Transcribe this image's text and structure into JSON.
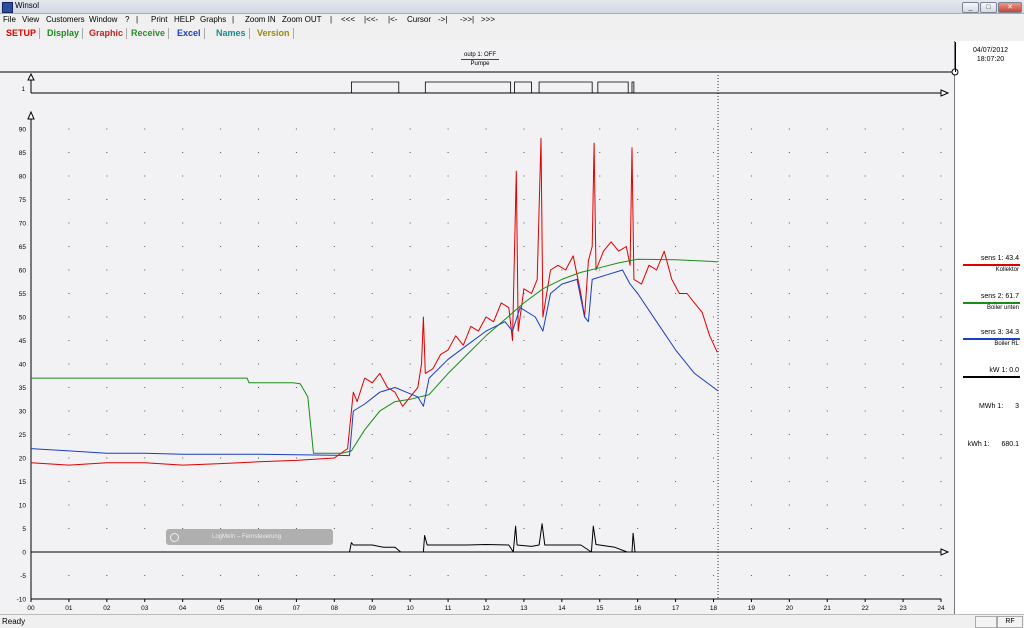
{
  "window": {
    "title": "Winsol"
  },
  "menu": [
    "File",
    "View",
    "Customers",
    "Window",
    "?",
    "|",
    "Print",
    "HELP",
    "Graphs",
    "|",
    "Zoom IN",
    "Zoom OUT",
    "|",
    "<<<",
    "|<<-",
    "|<-",
    "Cursor",
    "->|",
    "->>|",
    ">>>"
  ],
  "toolbar": [
    {
      "label": "SETUP",
      "color": "#e00000"
    },
    {
      "label": "Display",
      "color": "#1a8c1a"
    },
    {
      "label": "Graphic",
      "color": "#c41e1e"
    },
    {
      "label": "Receive",
      "color": "#2e8b2e"
    },
    {
      "label": "Excel",
      "color": "#1a3fbf"
    },
    {
      "label": "Names",
      "color": "#138f8f"
    },
    {
      "label": "Version",
      "color": "#9a8a0a"
    }
  ],
  "header": {
    "date": "04/07/2012",
    "time": "18:07:20",
    "output_label": "outp 1: OFF",
    "output_name": "Pumpe"
  },
  "legend": [
    {
      "label": "sens 1:",
      "value": "43.4",
      "name": "Kollektor",
      "color": "#e00000"
    },
    {
      "label": "sens 2:",
      "value": "61.7",
      "name": "Boiler unten",
      "color": "#1a8c1a"
    },
    {
      "label": "sens 3:",
      "value": "34.3",
      "name": "Boiler RL",
      "color": "#1a3fbf"
    },
    {
      "label": "kW 1:",
      "value": "0.0",
      "name": "",
      "color": "#000000"
    }
  ],
  "counters": [
    {
      "label": "MWh 1:",
      "value": "3"
    },
    {
      "label": "kWh 1:",
      "value": "680.1"
    }
  ],
  "status": {
    "text": "Ready",
    "rf": "RF"
  },
  "toast": {
    "text": "LogMeIn – Fernsteuerung"
  },
  "chart_data": {
    "type": "line",
    "xlabel": "",
    "ylabel": "",
    "xlim": [
      0,
      24
    ],
    "ylim": [
      -10,
      90
    ],
    "x_ticks": [
      "00",
      "01",
      "02",
      "03",
      "04",
      "05",
      "06",
      "07",
      "08",
      "09",
      "10",
      "11",
      "12",
      "13",
      "14",
      "15",
      "16",
      "17",
      "18",
      "19",
      "20",
      "21",
      "22",
      "23",
      "24"
    ],
    "y_ticks": [
      -10,
      -5,
      0,
      5,
      10,
      15,
      20,
      25,
      30,
      35,
      40,
      45,
      50,
      55,
      60,
      65,
      70,
      75,
      80,
      85,
      90
    ],
    "cursor_x": 18.12,
    "pump": {
      "label": "1",
      "on_intervals": [
        [
          8.45,
          9.7
        ],
        [
          10.4,
          12.65
        ],
        [
          12.75,
          13.2
        ],
        [
          13.4,
          14.8
        ],
        [
          14.95,
          15.75
        ],
        [
          15.85,
          15.9
        ]
      ]
    },
    "series": [
      {
        "name": "Kollektor",
        "color": "#e00000",
        "points": [
          [
            0,
            19
          ],
          [
            1,
            18.5
          ],
          [
            2,
            19
          ],
          [
            3,
            19
          ],
          [
            4,
            18.5
          ],
          [
            5,
            18.8
          ],
          [
            6,
            19.2
          ],
          [
            7,
            19.5
          ],
          [
            8,
            20
          ],
          [
            8.35,
            22
          ],
          [
            8.5,
            34
          ],
          [
            8.6,
            32
          ],
          [
            8.8,
            37
          ],
          [
            9,
            36
          ],
          [
            9.2,
            38
          ],
          [
            9.4,
            35
          ],
          [
            9.6,
            34
          ],
          [
            9.8,
            31
          ],
          [
            10,
            33
          ],
          [
            10.2,
            35
          ],
          [
            10.3,
            40
          ],
          [
            10.35,
            50
          ],
          [
            10.4,
            38
          ],
          [
            10.6,
            39
          ],
          [
            10.8,
            42
          ],
          [
            11,
            43
          ],
          [
            11.2,
            46
          ],
          [
            11.4,
            44
          ],
          [
            11.6,
            48
          ],
          [
            11.8,
            47
          ],
          [
            12,
            50
          ],
          [
            12.2,
            49
          ],
          [
            12.4,
            53
          ],
          [
            12.6,
            52
          ],
          [
            12.7,
            45
          ],
          [
            12.8,
            81
          ],
          [
            12.85,
            47
          ],
          [
            13,
            56
          ],
          [
            13.2,
            55
          ],
          [
            13.35,
            58
          ],
          [
            13.45,
            88
          ],
          [
            13.5,
            50
          ],
          [
            13.7,
            60
          ],
          [
            13.9,
            61
          ],
          [
            14.1,
            60
          ],
          [
            14.3,
            63
          ],
          [
            14.5,
            55
          ],
          [
            14.6,
            50
          ],
          [
            14.7,
            62
          ],
          [
            14.8,
            65
          ],
          [
            14.85,
            87
          ],
          [
            14.9,
            60
          ],
          [
            15.1,
            64
          ],
          [
            15.3,
            66
          ],
          [
            15.5,
            64
          ],
          [
            15.7,
            65
          ],
          [
            15.8,
            61
          ],
          [
            15.85,
            86
          ],
          [
            15.9,
            58
          ],
          [
            16.1,
            57
          ],
          [
            16.3,
            61
          ],
          [
            16.5,
            60
          ],
          [
            16.7,
            64
          ],
          [
            16.9,
            58
          ],
          [
            17.1,
            55
          ],
          [
            17.3,
            55
          ],
          [
            17.5,
            53
          ],
          [
            17.7,
            51
          ],
          [
            17.9,
            46
          ],
          [
            18.1,
            42.5
          ]
        ]
      },
      {
        "name": "Boiler unten",
        "color": "#1a8c1a",
        "points": [
          [
            0,
            37
          ],
          [
            5.7,
            37
          ],
          [
            5.75,
            36
          ],
          [
            6.9,
            36
          ],
          [
            7.1,
            35.8
          ],
          [
            7.3,
            33
          ],
          [
            7.45,
            21
          ],
          [
            7.8,
            21
          ],
          [
            8.2,
            21
          ],
          [
            8.45,
            21.5
          ],
          [
            8.8,
            26
          ],
          [
            9.2,
            30
          ],
          [
            9.6,
            32
          ],
          [
            10,
            32.5
          ],
          [
            10.5,
            33.5
          ],
          [
            11,
            38
          ],
          [
            11.5,
            42
          ],
          [
            12,
            46
          ],
          [
            12.5,
            49.5
          ],
          [
            13,
            53
          ],
          [
            13.5,
            56
          ],
          [
            14,
            58
          ],
          [
            14.5,
            59.5
          ],
          [
            15,
            60.5
          ],
          [
            15.5,
            61.5
          ],
          [
            16,
            62.3
          ],
          [
            17,
            62.2
          ],
          [
            18,
            61.8
          ],
          [
            18.1,
            61.7
          ]
        ]
      },
      {
        "name": "Boiler RL",
        "color": "#1a3fbf",
        "points": [
          [
            0,
            22
          ],
          [
            1,
            21.5
          ],
          [
            2,
            21
          ],
          [
            3,
            21
          ],
          [
            4,
            20.8
          ],
          [
            5,
            20.8
          ],
          [
            6,
            20.8
          ],
          [
            7,
            20.7
          ],
          [
            8,
            20.6
          ],
          [
            8.4,
            20.5
          ],
          [
            8.5,
            30
          ],
          [
            8.8,
            31.5
          ],
          [
            9.2,
            34
          ],
          [
            9.6,
            35
          ],
          [
            9.9,
            34
          ],
          [
            10.2,
            33
          ],
          [
            10.35,
            31
          ],
          [
            10.5,
            37
          ],
          [
            11,
            41
          ],
          [
            11.5,
            44
          ],
          [
            12,
            47
          ],
          [
            12.5,
            49
          ],
          [
            12.7,
            47
          ],
          [
            12.9,
            52
          ],
          [
            13.3,
            50
          ],
          [
            13.5,
            47
          ],
          [
            13.7,
            55
          ],
          [
            14,
            57
          ],
          [
            14.4,
            58
          ],
          [
            14.6,
            50
          ],
          [
            14.7,
            49
          ],
          [
            14.8,
            58
          ],
          [
            15.2,
            59
          ],
          [
            15.6,
            60
          ],
          [
            15.8,
            57
          ],
          [
            16,
            55
          ],
          [
            16.5,
            49
          ],
          [
            17,
            43
          ],
          [
            17.5,
            38
          ],
          [
            18,
            35
          ],
          [
            18.12,
            34.3
          ]
        ]
      },
      {
        "name": "kW 1",
        "color": "#000000",
        "points": [
          [
            0,
            0
          ],
          [
            8.4,
            0
          ],
          [
            8.45,
            2
          ],
          [
            8.5,
            1.5
          ],
          [
            9,
            1.5
          ],
          [
            9.3,
            1
          ],
          [
            9.6,
            1
          ],
          [
            9.75,
            0
          ],
          [
            10.35,
            0
          ],
          [
            10.38,
            3.5
          ],
          [
            10.45,
            1.5
          ],
          [
            11,
            1.5
          ],
          [
            11.5,
            1.5
          ],
          [
            12,
            1.6
          ],
          [
            12.6,
            1.5
          ],
          [
            12.72,
            0
          ],
          [
            12.78,
            5.5
          ],
          [
            12.82,
            1.5
          ],
          [
            13.2,
            1.2
          ],
          [
            13.4,
            1.5
          ],
          [
            13.48,
            6
          ],
          [
            13.55,
            1.5
          ],
          [
            14,
            1.5
          ],
          [
            14.5,
            1.5
          ],
          [
            14.78,
            0
          ],
          [
            14.83,
            5.5
          ],
          [
            14.9,
            1.6
          ],
          [
            15.4,
            1
          ],
          [
            15.72,
            0
          ],
          [
            15.85,
            0
          ],
          [
            15.88,
            4
          ],
          [
            15.93,
            0
          ],
          [
            18.12,
            0
          ]
        ]
      }
    ]
  }
}
